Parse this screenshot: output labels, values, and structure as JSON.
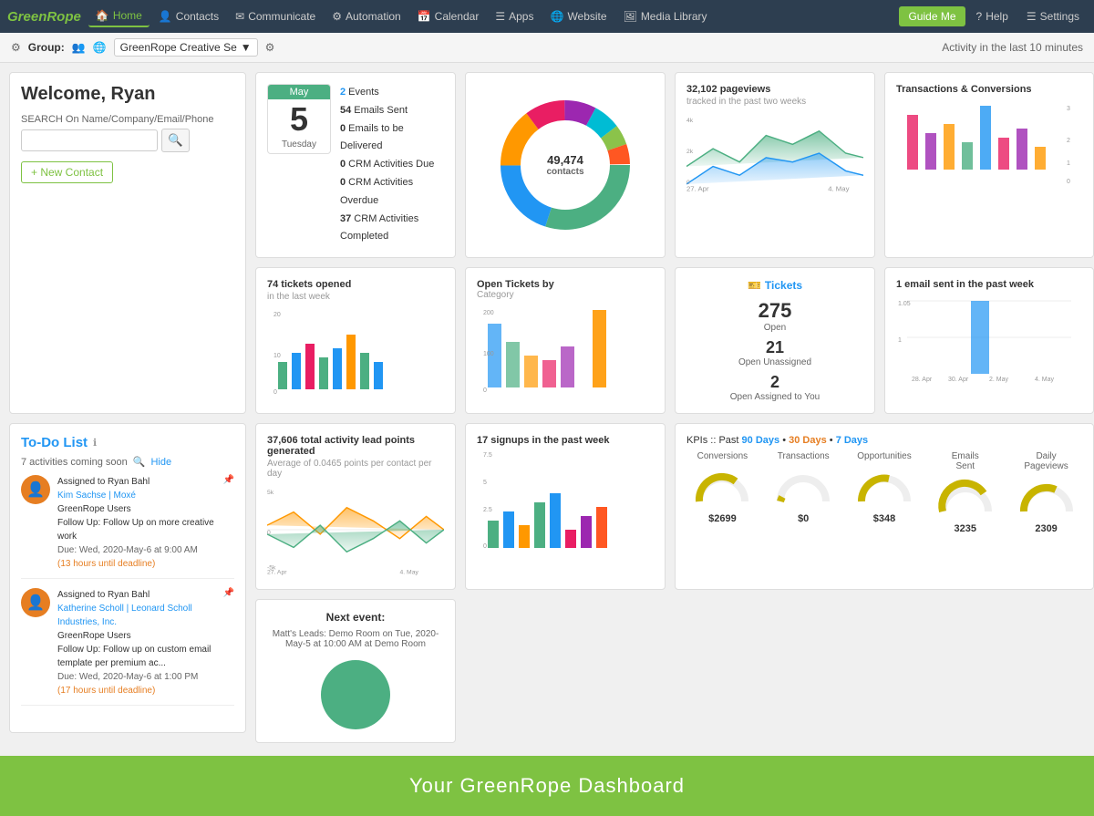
{
  "nav": {
    "logo": "GreenRope",
    "items": [
      {
        "label": "Home",
        "icon": "🏠",
        "active": true
      },
      {
        "label": "Contacts",
        "icon": "👤"
      },
      {
        "label": "Communicate",
        "icon": "✉"
      },
      {
        "label": "Automation",
        "icon": "⚙"
      },
      {
        "label": "Calendar",
        "icon": "📅"
      },
      {
        "label": "Apps",
        "icon": "☰"
      },
      {
        "label": "Website",
        "icon": "🌐"
      },
      {
        "label": "Media Library",
        "icon": "🖼"
      }
    ],
    "guide_me": "Guide Me",
    "help": "Help",
    "settings": "Settings"
  },
  "toolbar": {
    "group_label": "Group:",
    "group_name": "GreenRope Creative Se",
    "activity_text": "Activity in the last 10 minutes"
  },
  "welcome": {
    "title": "Welcome, Ryan",
    "search_label": "SEARCH On Name/Company/Email/Phone",
    "search_placeholder": "",
    "new_contact": "+ New Contact"
  },
  "events": {
    "month": "May",
    "day": "5",
    "weekday": "Tuesday",
    "items": [
      {
        "count": "2",
        "label": "Events"
      },
      {
        "count": "54",
        "label": "Emails Sent"
      },
      {
        "count": "0",
        "label": "Emails to be Delivered"
      },
      {
        "count": "0",
        "label": "CRM Activities Due"
      },
      {
        "count": "0",
        "label": "CRM Activities Overdue"
      },
      {
        "count": "37",
        "label": "CRM Activities Completed"
      }
    ]
  },
  "donut": {
    "center_value": "49,474",
    "center_label": "contacts",
    "segments": [
      {
        "color": "#4caf82",
        "value": 30
      },
      {
        "color": "#2196F3",
        "value": 20
      },
      {
        "color": "#ff9800",
        "value": 15
      },
      {
        "color": "#e91e63",
        "value": 10
      },
      {
        "color": "#9c27b0",
        "value": 8
      },
      {
        "color": "#00bcd4",
        "value": 7
      },
      {
        "color": "#8bc34a",
        "value": 5
      },
      {
        "color": "#ff5722",
        "value": 5
      }
    ]
  },
  "pageviews": {
    "count": "32,102 pageviews",
    "subtitle": "tracked in the past two weeks",
    "y_labels": [
      "4k",
      "2k",
      "0"
    ],
    "x_labels": [
      "27. Apr",
      "4. May"
    ]
  },
  "transactions": {
    "title": "Transactions & Conversions",
    "y_labels": [
      "3",
      "2",
      "1",
      "0"
    ]
  },
  "todo": {
    "title": "To-Do List",
    "coming_soon": "7 activities coming soon",
    "hide": "Hide",
    "items": [
      {
        "avatar": "👤",
        "assigned": "Assigned to Ryan Bahl",
        "contact": "Kim Sachse | Moxé",
        "group": "GreenRope Users",
        "followup": "Follow Up: Follow Up on more creative work",
        "due": "Due: Wed, 2020-May-6 at 9:00 AM",
        "deadline": "(13 hours until deadline)"
      },
      {
        "avatar": "👤",
        "assigned": "Assigned to Ryan Bahl",
        "contact": "Katherine Scholl | Leonard Scholl Industries, Inc.",
        "group": "GreenRope Users",
        "followup": "Follow Up: Follow up on custom email template per premium ac...",
        "due": "Due: Wed, 2020-May-6 at 1:00 PM",
        "deadline": "(17 hours until deadline)"
      }
    ]
  },
  "tickets_chart": {
    "title": "74 tickets opened",
    "subtitle": "in the last week",
    "y_labels": [
      "20",
      "10",
      "0"
    ]
  },
  "tickets_by_cat": {
    "title": "Open Tickets by",
    "subtitle": "Category",
    "y_labels": [
      "200",
      "100",
      "0"
    ]
  },
  "open_tickets": {
    "icon": "🎫",
    "label": "Tickets",
    "open_count": "275",
    "open_label": "Open",
    "unassigned_count": "21",
    "unassigned_label": "Open Unassigned",
    "assigned_count": "2",
    "assigned_label": "Open Assigned to You"
  },
  "email_sent": {
    "title": "1 email sent in the past week",
    "y_labels": [
      "1.05",
      "1",
      ""
    ],
    "x_labels": [
      "28. Apr",
      "30. Apr",
      "2. May",
      "4. May"
    ]
  },
  "lead_points": {
    "title": "37,606 total activity lead points generated",
    "subtitle": "Average of 0.0465 points per contact per day",
    "y_labels": [
      "5k",
      "0",
      "-5k"
    ],
    "x_labels": [
      "27. Apr",
      "4. May"
    ]
  },
  "signups": {
    "title": "17 signups in the past week",
    "y_labels": [
      "7.5",
      "5",
      "2.5",
      "0"
    ]
  },
  "next_event": {
    "title": "Next event:",
    "detail": "Matt's Leads: Demo Room on Tue, 2020-May-5 at 10:00 AM at Demo Room"
  },
  "kpi": {
    "title": "KPIs :: Past",
    "options": [
      "90 Days",
      "30 Days",
      "7 Days"
    ],
    "active": "30 Days",
    "items": [
      {
        "label": "Conversions",
        "value": "$2699",
        "color": "#c8b400"
      },
      {
        "label": "Transactions",
        "value": "$0",
        "color": "#c8b400"
      },
      {
        "label": "Opportunities",
        "value": "$348",
        "color": "#c8b400"
      },
      {
        "label": "Emails Sent",
        "value": "3235",
        "color": "#c8b400"
      },
      {
        "label": "Daily Pageviews",
        "value": "2309",
        "color": "#c8b400"
      }
    ]
  },
  "footer": {
    "text": "Your GreenRope Dashboard"
  }
}
